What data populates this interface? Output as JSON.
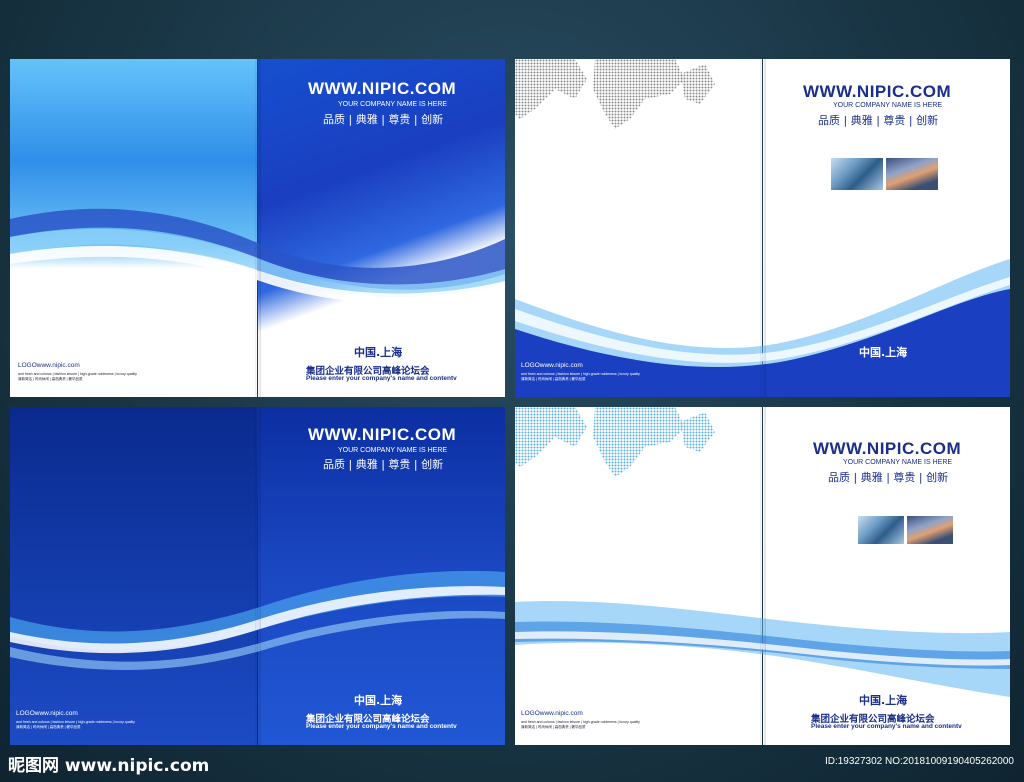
{
  "site_url": "WWW.NIPIC.COM",
  "company_placeholder": "YOUR COMPANY NAME IS HERE",
  "slogan": "品质 | 典雅 | 尊贵 | 创新",
  "city": "中国.上海",
  "group_name": "集团企业有限公司高峰论坛会",
  "enter_text": "Please enter your company's name and contentv",
  "logo_text": "LOGOwww.nipic.com",
  "small_line_1": "and fresh and colorus  |  fashion leisure  |  high-grade nobleness  |  luxury quality",
  "small_line_2": "清新简洁  |  时尚休闲  |  高档典贵  |  奢华品质",
  "watermark_left": "昵图网 www.nipic.com",
  "watermark_right": "ID:19327302 NO:20181009190405262000",
  "colors": {
    "navy_text": "#1a2e8a",
    "brand_blue": "#1a3fc0",
    "deep_blue": "#0d2a9e",
    "light_blue": "#5fb7f2"
  }
}
